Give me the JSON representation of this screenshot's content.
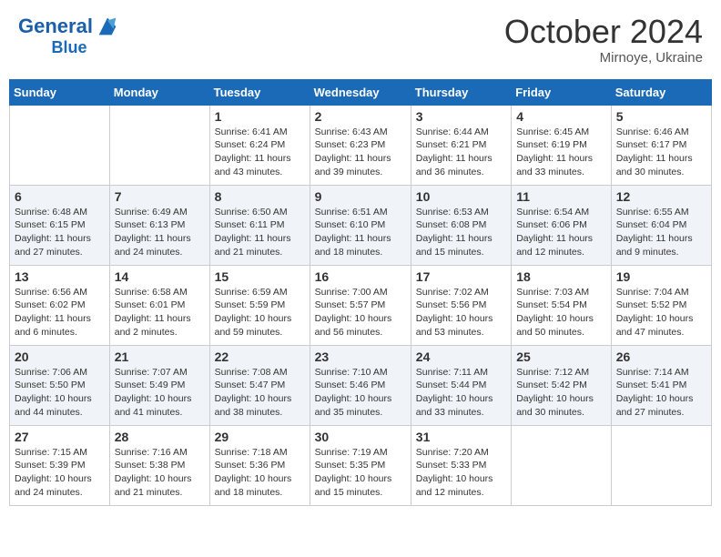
{
  "header": {
    "logo_general": "General",
    "logo_blue": "Blue",
    "month": "October 2024",
    "location": "Mirnoye, Ukraine"
  },
  "weekdays": [
    "Sunday",
    "Monday",
    "Tuesday",
    "Wednesday",
    "Thursday",
    "Friday",
    "Saturday"
  ],
  "weeks": [
    [
      {
        "day": "",
        "sunrise": "",
        "sunset": "",
        "daylight": ""
      },
      {
        "day": "",
        "sunrise": "",
        "sunset": "",
        "daylight": ""
      },
      {
        "day": "1",
        "sunrise": "Sunrise: 6:41 AM",
        "sunset": "Sunset: 6:24 PM",
        "daylight": "Daylight: 11 hours and 43 minutes."
      },
      {
        "day": "2",
        "sunrise": "Sunrise: 6:43 AM",
        "sunset": "Sunset: 6:23 PM",
        "daylight": "Daylight: 11 hours and 39 minutes."
      },
      {
        "day": "3",
        "sunrise": "Sunrise: 6:44 AM",
        "sunset": "Sunset: 6:21 PM",
        "daylight": "Daylight: 11 hours and 36 minutes."
      },
      {
        "day": "4",
        "sunrise": "Sunrise: 6:45 AM",
        "sunset": "Sunset: 6:19 PM",
        "daylight": "Daylight: 11 hours and 33 minutes."
      },
      {
        "day": "5",
        "sunrise": "Sunrise: 6:46 AM",
        "sunset": "Sunset: 6:17 PM",
        "daylight": "Daylight: 11 hours and 30 minutes."
      }
    ],
    [
      {
        "day": "6",
        "sunrise": "Sunrise: 6:48 AM",
        "sunset": "Sunset: 6:15 PM",
        "daylight": "Daylight: 11 hours and 27 minutes."
      },
      {
        "day": "7",
        "sunrise": "Sunrise: 6:49 AM",
        "sunset": "Sunset: 6:13 PM",
        "daylight": "Daylight: 11 hours and 24 minutes."
      },
      {
        "day": "8",
        "sunrise": "Sunrise: 6:50 AM",
        "sunset": "Sunset: 6:11 PM",
        "daylight": "Daylight: 11 hours and 21 minutes."
      },
      {
        "day": "9",
        "sunrise": "Sunrise: 6:51 AM",
        "sunset": "Sunset: 6:10 PM",
        "daylight": "Daylight: 11 hours and 18 minutes."
      },
      {
        "day": "10",
        "sunrise": "Sunrise: 6:53 AM",
        "sunset": "Sunset: 6:08 PM",
        "daylight": "Daylight: 11 hours and 15 minutes."
      },
      {
        "day": "11",
        "sunrise": "Sunrise: 6:54 AM",
        "sunset": "Sunset: 6:06 PM",
        "daylight": "Daylight: 11 hours and 12 minutes."
      },
      {
        "day": "12",
        "sunrise": "Sunrise: 6:55 AM",
        "sunset": "Sunset: 6:04 PM",
        "daylight": "Daylight: 11 hours and 9 minutes."
      }
    ],
    [
      {
        "day": "13",
        "sunrise": "Sunrise: 6:56 AM",
        "sunset": "Sunset: 6:02 PM",
        "daylight": "Daylight: 11 hours and 6 minutes."
      },
      {
        "day": "14",
        "sunrise": "Sunrise: 6:58 AM",
        "sunset": "Sunset: 6:01 PM",
        "daylight": "Daylight: 11 hours and 2 minutes."
      },
      {
        "day": "15",
        "sunrise": "Sunrise: 6:59 AM",
        "sunset": "Sunset: 5:59 PM",
        "daylight": "Daylight: 10 hours and 59 minutes."
      },
      {
        "day": "16",
        "sunrise": "Sunrise: 7:00 AM",
        "sunset": "Sunset: 5:57 PM",
        "daylight": "Daylight: 10 hours and 56 minutes."
      },
      {
        "day": "17",
        "sunrise": "Sunrise: 7:02 AM",
        "sunset": "Sunset: 5:56 PM",
        "daylight": "Daylight: 10 hours and 53 minutes."
      },
      {
        "day": "18",
        "sunrise": "Sunrise: 7:03 AM",
        "sunset": "Sunset: 5:54 PM",
        "daylight": "Daylight: 10 hours and 50 minutes."
      },
      {
        "day": "19",
        "sunrise": "Sunrise: 7:04 AM",
        "sunset": "Sunset: 5:52 PM",
        "daylight": "Daylight: 10 hours and 47 minutes."
      }
    ],
    [
      {
        "day": "20",
        "sunrise": "Sunrise: 7:06 AM",
        "sunset": "Sunset: 5:50 PM",
        "daylight": "Daylight: 10 hours and 44 minutes."
      },
      {
        "day": "21",
        "sunrise": "Sunrise: 7:07 AM",
        "sunset": "Sunset: 5:49 PM",
        "daylight": "Daylight: 10 hours and 41 minutes."
      },
      {
        "day": "22",
        "sunrise": "Sunrise: 7:08 AM",
        "sunset": "Sunset: 5:47 PM",
        "daylight": "Daylight: 10 hours and 38 minutes."
      },
      {
        "day": "23",
        "sunrise": "Sunrise: 7:10 AM",
        "sunset": "Sunset: 5:46 PM",
        "daylight": "Daylight: 10 hours and 35 minutes."
      },
      {
        "day": "24",
        "sunrise": "Sunrise: 7:11 AM",
        "sunset": "Sunset: 5:44 PM",
        "daylight": "Daylight: 10 hours and 33 minutes."
      },
      {
        "day": "25",
        "sunrise": "Sunrise: 7:12 AM",
        "sunset": "Sunset: 5:42 PM",
        "daylight": "Daylight: 10 hours and 30 minutes."
      },
      {
        "day": "26",
        "sunrise": "Sunrise: 7:14 AM",
        "sunset": "Sunset: 5:41 PM",
        "daylight": "Daylight: 10 hours and 27 minutes."
      }
    ],
    [
      {
        "day": "27",
        "sunrise": "Sunrise: 7:15 AM",
        "sunset": "Sunset: 5:39 PM",
        "daylight": "Daylight: 10 hours and 24 minutes."
      },
      {
        "day": "28",
        "sunrise": "Sunrise: 7:16 AM",
        "sunset": "Sunset: 5:38 PM",
        "daylight": "Daylight: 10 hours and 21 minutes."
      },
      {
        "day": "29",
        "sunrise": "Sunrise: 7:18 AM",
        "sunset": "Sunset: 5:36 PM",
        "daylight": "Daylight: 10 hours and 18 minutes."
      },
      {
        "day": "30",
        "sunrise": "Sunrise: 7:19 AM",
        "sunset": "Sunset: 5:35 PM",
        "daylight": "Daylight: 10 hours and 15 minutes."
      },
      {
        "day": "31",
        "sunrise": "Sunrise: 7:20 AM",
        "sunset": "Sunset: 5:33 PM",
        "daylight": "Daylight: 10 hours and 12 minutes."
      },
      {
        "day": "",
        "sunrise": "",
        "sunset": "",
        "daylight": ""
      },
      {
        "day": "",
        "sunrise": "",
        "sunset": "",
        "daylight": ""
      }
    ]
  ]
}
